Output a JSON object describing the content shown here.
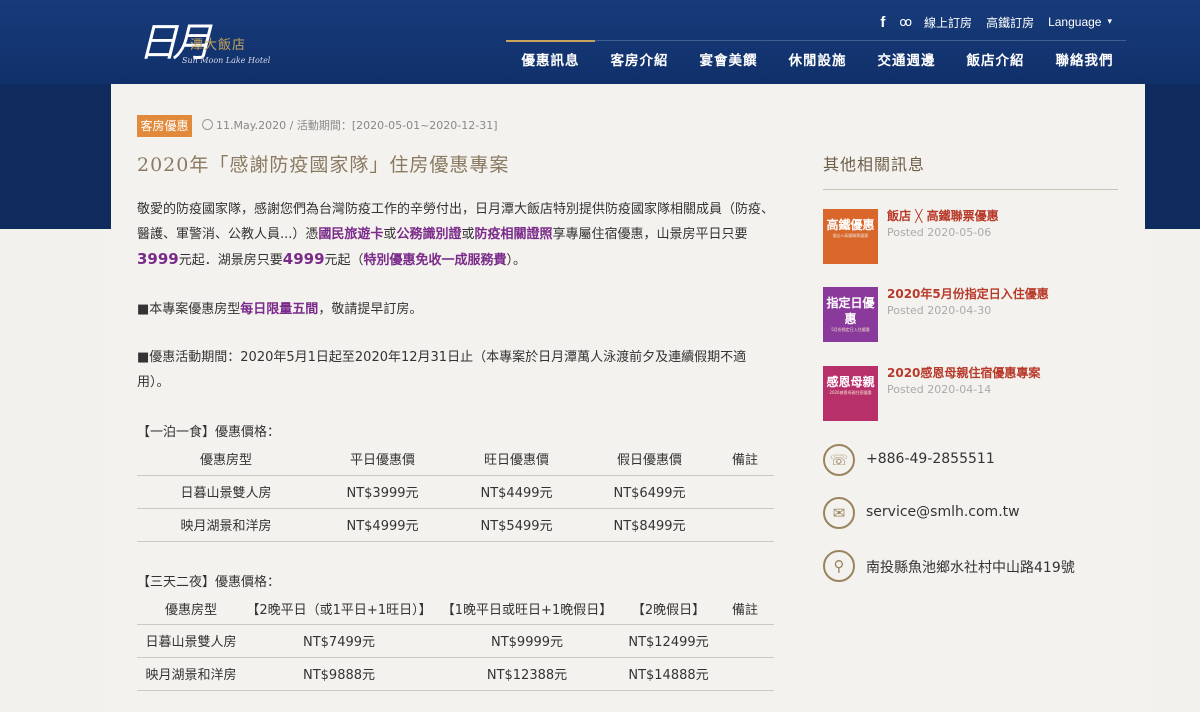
{
  "header": {
    "logo_glyph": "日月",
    "logo_cn": "潭大飯店",
    "logo_en": "Sun Moon Lake Hotel",
    "top_links": {
      "facebook_icon": "f",
      "tripadvisor_icon": "oo",
      "online_booking": "線上訂房",
      "hsr_booking": "高鐵訂房",
      "language": "Language",
      "caret": "▾"
    },
    "nav": [
      "優惠訊息",
      "客房介紹",
      "宴會美饌",
      "休閒設施",
      "交通週邊",
      "飯店介紹",
      "聯絡我們"
    ],
    "active_nav_index": 0
  },
  "article": {
    "tag": "客房優惠",
    "date": "11.May.2020",
    "period_label": " / 活動期間：",
    "period_value": "[2020-05-01~2020-12-31]",
    "title": "2020年「感謝防疫國家隊」住房優惠專案",
    "intro": {
      "p1": "敬愛的防疫國家隊，感謝您們為台灣防疫工作的辛勞付出，日月潭大飯店特別提供防疫國家隊相關成員（防疫、醫護、軍警消、公教人員...）憑",
      "h1": "國民旅遊卡",
      "p2": "或",
      "h2": "公務識別證",
      "p3": "或",
      "h3": "防疫相關證照",
      "p4": "享專屬住宿優惠，山景房平日只要",
      "h4": "3999",
      "p5": "元起．湖景房只要",
      "h5": "4999",
      "p6": "元起（",
      "h6": "特別優惠免收一成服務費",
      "p7": "）。"
    },
    "note1": {
      "a": "■本專案優惠房型",
      "b": "每日限量五間",
      "c": "，敬請提早訂房。"
    },
    "note2": "■優惠活動期間：2020年5月1日起至2020年12月31日止（本專案於日月潭萬人泳渡前夕及連續假期不適用）。",
    "table1": {
      "title": "【一泊一食】優惠價格：",
      "headers": [
        "優惠房型",
        "平日優惠價",
        "旺日優惠價",
        "假日優惠價",
        "備註"
      ],
      "rows": [
        [
          "日暮山景雙人房",
          "NT$3999元",
          "NT$4499元",
          "NT$6499元",
          ""
        ],
        [
          "映月湖景和洋房",
          "NT$4999元",
          "NT$5499元",
          "NT$8499元",
          ""
        ]
      ]
    },
    "table2": {
      "title": "【三天二夜】優惠價格：",
      "headers": [
        "優惠房型",
        "【2晚平日（或1平日+1旺日）】",
        "【1晚平日或旺日+1晚假日】",
        "【2晚假日】",
        "備註"
      ],
      "rows": [
        [
          "日暮山景雙人房",
          "NT$7499元",
          "NT$9999元",
          "NT$12499元",
          ""
        ],
        [
          "映月湖景和洋房",
          "NT$9888元",
          "NT$12388元",
          "NT$14888元",
          ""
        ]
      ]
    }
  },
  "sidebar": {
    "title": "其他相關訊息",
    "news": [
      {
        "thumb": "高鐵優惠",
        "thumb_sub": "飯店×高鐵聯票優惠",
        "thumb_color": "#d9662a",
        "title": "飯店 ╳ 高鐵聯票優惠",
        "date": "Posted 2020-05-06"
      },
      {
        "thumb": "指定日優惠",
        "thumb_sub": "5月份指定日入住優惠",
        "thumb_color": "#8a3a9a",
        "title": "2020年5月份指定日入住優惠",
        "date": "Posted 2020-04-30"
      },
      {
        "thumb": "感恩母親",
        "thumb_sub": "2020感恩母親住宿優惠",
        "thumb_color": "#b8306a",
        "title": "2020感恩母親住宿優惠專案",
        "date": "Posted 2020-04-14"
      }
    ],
    "contacts": [
      {
        "icon": "☏",
        "text": "+886-49-2855511"
      },
      {
        "icon": "✉",
        "text": "service@smlh.com.tw"
      },
      {
        "icon": "⚲",
        "text": "南投縣魚池鄉水社村中山路419號"
      }
    ]
  }
}
